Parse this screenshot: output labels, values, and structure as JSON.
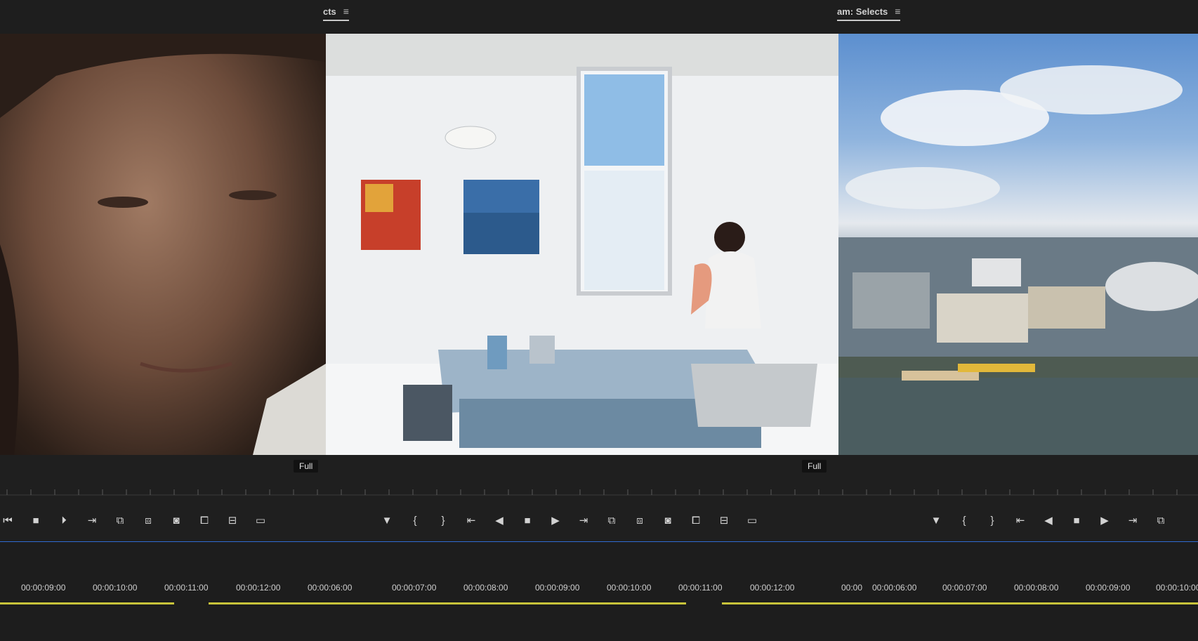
{
  "header": {
    "tabs": [
      {
        "label": "cts"
      },
      {
        "label": "am: Selects"
      }
    ]
  },
  "viewers": {
    "zoom_left": "Full",
    "zoom_right": "Full"
  },
  "timecodes_left": [
    "00:00:09:00",
    "00:00:10:00",
    "00:00:11:00",
    "00:00:12:00",
    "00:00:06:00",
    "00:00:07:00",
    "00:00:08:00",
    "00:00:09:00",
    "00:00:10:00",
    "00:00:11:00",
    "00:00:12:00"
  ],
  "timecodes_right": [
    "00:00",
    "00:00:06:00",
    "00:00:07:00",
    "00:00:08:00",
    "00:00:09:00",
    "00:00:10:00"
  ],
  "colors": {
    "accent_blue": "#2f6bd1",
    "in_out_yellow": "#c8c33a",
    "panel_bg": "#1f1f1f"
  },
  "icons": [
    "play-backward-icon",
    "stop-icon",
    "step-forward-icon",
    "go-to-out-icon",
    "insert-icon",
    "overwrite-icon",
    "camera-icon",
    "compare-icon",
    "settings-icon",
    "marker-icon",
    "mark-in-icon",
    "mark-out-icon"
  ]
}
